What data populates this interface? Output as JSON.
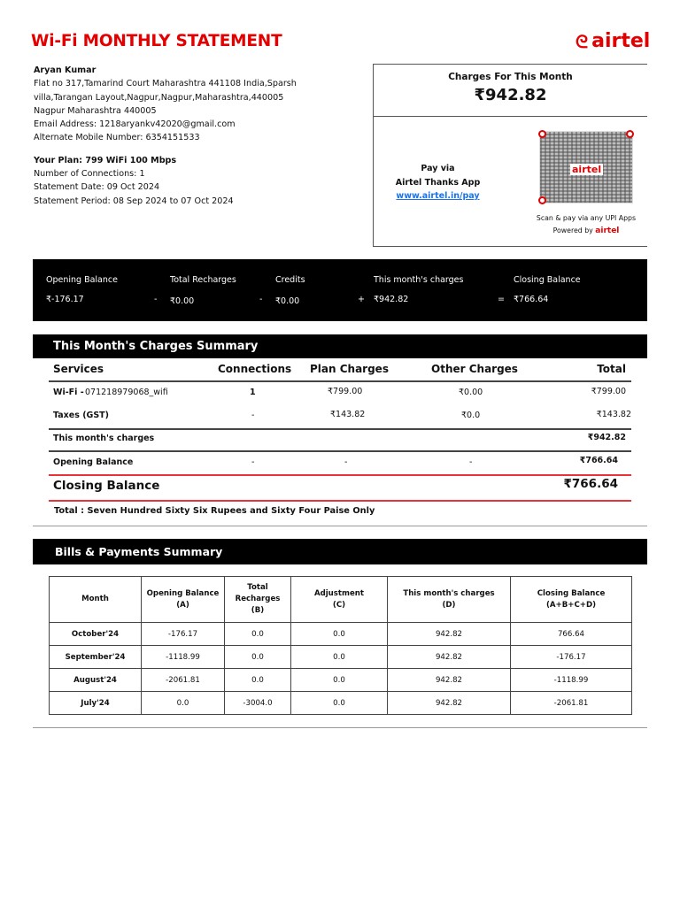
{
  "header": {
    "title": "Wi-Fi MONTHLY STATEMENT",
    "logo": "airtel"
  },
  "customer": {
    "name": "Aryan Kumar",
    "address_line1": "Flat no 317,Tamarind Court Maharashtra 441108 India,Sparsh",
    "address_line2": "villa,Tarangan Layout,Nagpur,Nagpur,Maharashtra,440005",
    "address_line3": "Nagpur Maharashtra 440005",
    "email": "Email Address: 1218aryankv42020@gmail.com",
    "alt_mobile": "Alternate Mobile Number: 6354151533",
    "plan": "Your Plan: 799 WiFi 100 Mbps",
    "connections": "Number of Connections:  1",
    "statement_date": "Statement Date:  09 Oct 2024",
    "statement_period": "Statement Period: 08 Sep 2024 to 07 Oct 2024"
  },
  "pay": {
    "title": "Charges For This Month",
    "amount": "₹942.82",
    "pay_via": "Pay via",
    "app": "Airtel Thanks App",
    "link": "www.airtel.in/pay",
    "qr_logo": "airtel",
    "scan": "Scan & pay via any UPI Apps",
    "powered": "Powered by",
    "powered_brand": "airtel"
  },
  "balance": {
    "labels": [
      "Opening Balance",
      "Total Recharges",
      "Credits",
      "This month's charges",
      "Closing Balance"
    ],
    "values": [
      "₹-176.17",
      "₹0.00",
      "₹0.00",
      "₹942.82",
      "₹766.64"
    ],
    "ops": [
      "-",
      "-",
      "+",
      "="
    ]
  },
  "summary": {
    "title": "This Month's Charges Summary",
    "headers": [
      "Services",
      "Connections",
      "Plan Charges",
      "Other Charges",
      "Total"
    ],
    "rows": [
      [
        "Wi-Fi -",
        "071218979068_wifi",
        "1",
        "₹799.00",
        "₹0.00",
        "₹799.00"
      ],
      [
        "Taxes (GST)",
        "",
        "-",
        "₹143.82",
        "₹0.0",
        "₹143.82"
      ]
    ],
    "this_month_label": "This month's charges",
    "this_month_total": "₹942.82",
    "opening": [
      "Opening Balance",
      "-",
      "-",
      "-",
      "₹766.64"
    ],
    "closing_label": "Closing Balance",
    "closing_value": "₹766.64",
    "words": "Total : Seven Hundred Sixty Six Rupees and Sixty Four Paise Only"
  },
  "bills": {
    "title": "Bills & Payments Summary",
    "headers": [
      [
        "Month"
      ],
      [
        "Opening Balance",
        "(A)"
      ],
      [
        "Total",
        "Recharges",
        "(B)"
      ],
      [
        "Adjustment",
        "(C)"
      ],
      [
        "This month's charges",
        "(D)"
      ],
      [
        "Closing Balance",
        "(A+B+C+D)"
      ]
    ],
    "rows": [
      [
        "October'24",
        "-176.17",
        "0.0",
        "0.0",
        "942.82",
        "766.64"
      ],
      [
        "September'24",
        "-1118.99",
        "0.0",
        "0.0",
        "942.82",
        "-176.17"
      ],
      [
        "August'24",
        "-2061.81",
        "0.0",
        "0.0",
        "942.82",
        "-1118.99"
      ],
      [
        "July'24",
        "0.0",
        "-3004.0",
        "0.0",
        "942.82",
        "-2061.81"
      ]
    ]
  }
}
